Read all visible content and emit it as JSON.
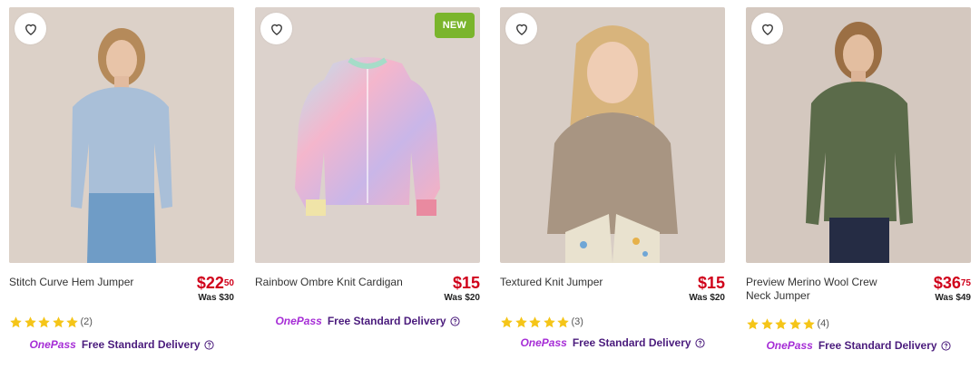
{
  "products": [
    {
      "name": "Stitch Curve Hem Jumper",
      "price_dollars": "$22",
      "price_cents": "50",
      "was": "Was $30",
      "rating_count": "(2)",
      "badge": ""
    },
    {
      "name": "Rainbow Ombre Knit Cardigan",
      "price_dollars": "$15",
      "price_cents": "",
      "was": "Was $20",
      "rating_count": "",
      "badge": "NEW"
    },
    {
      "name": "Textured Knit Jumper",
      "price_dollars": "$15",
      "price_cents": "",
      "was": "Was $20",
      "rating_count": "(3)",
      "badge": ""
    },
    {
      "name": "Preview Merino Wool Crew Neck Jumper",
      "price_dollars": "$36",
      "price_cents": "75",
      "was": "Was $49",
      "rating_count": "(4)",
      "badge": ""
    }
  ],
  "delivery": {
    "brand": "OnePass",
    "text": "Free Standard Delivery"
  },
  "icons": {
    "favourite": "heart-outline-icon",
    "star": "star-icon",
    "info": "question-circle-icon"
  },
  "colors": {
    "price": "#d0021b",
    "star": "#f5c518",
    "onepass": "#a62dd6",
    "badge_new": "#7ab52c"
  }
}
